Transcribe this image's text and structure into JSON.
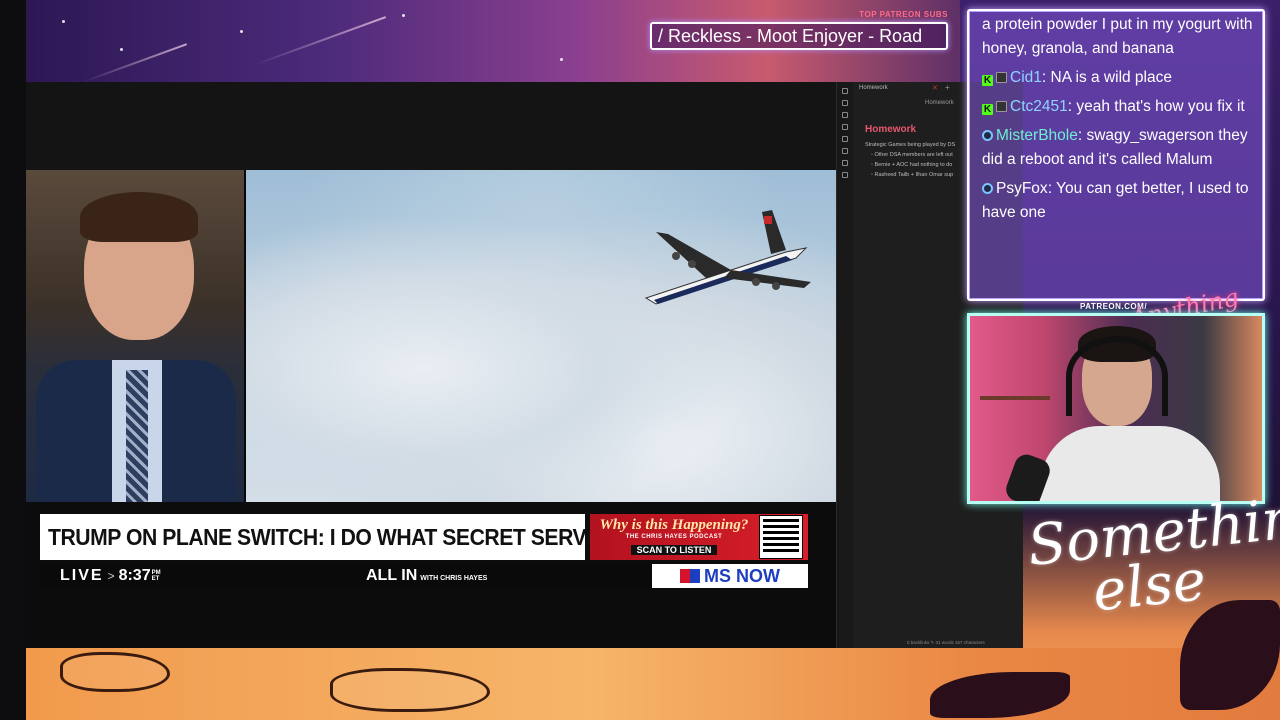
{
  "overlay": {
    "patreon_label": "TOP PATREON SUBS",
    "patreon_names": "/ Reckless - Moot Enjoyer - Road",
    "cam_label": "PATREON.COM/",
    "cam_script": "Anything else",
    "brand_script_line1": "Something",
    "brand_script_line2": "else"
  },
  "news": {
    "headline": "TRUMP ON PLANE SWITCH: I DO WHAT SECRET SERVICE SAYS",
    "promo_title": "Why is this Happening?",
    "promo_sub": "THE CHRIS HAYES PODCAST",
    "promo_scan": "SCAN TO LISTEN",
    "live": "LIVE",
    "time": "8:37",
    "tz_top": "PM",
    "tz_bottom": "ET",
    "show": "ALL IN",
    "show_with": "WITH CHRIS HAYES",
    "network": "MS NOW"
  },
  "notes": {
    "tab": "Homework",
    "crumb": "Homework",
    "title": "Homework",
    "lines": [
      "Strategic Games being played by DS",
      "◦ Other DSA members are left out",
      "◦ Bernie + AOC had nothing to do",
      "◦ Rasheed Tailb + Ilhan Omar sup"
    ],
    "footer": "0 backlinks   ✎   31 words  167 characters"
  },
  "chat": {
    "messages": [
      {
        "badges": [],
        "user": "",
        "user_color": "#ffffff",
        "text": "a protein powder I put in my yogurt with honey, granola, and banana"
      },
      {
        "badges": [
          "k",
          "sq"
        ],
        "user": "Cid1",
        "user_color": "#8fd3ff",
        "text": "NA is a wild place"
      },
      {
        "badges": [
          "k",
          "sq"
        ],
        "user": "Ctc2451",
        "user_color": "#8fd3ff",
        "text": "yeah that's how you fix it"
      },
      {
        "badges": [
          "dot"
        ],
        "user": "MisterBhole",
        "user_color": "#6ef0d0",
        "text": "swagy_swagerson they did a reboot and it's called Malum"
      },
      {
        "badges": [
          "dot"
        ],
        "user": "PsyFox",
        "user_color": "#ffffff",
        "text": "You can get better, I used to have one"
      }
    ]
  },
  "colors": {
    "accent_red": "#d81f2a",
    "network_blue": "#1d3fbf",
    "chat_border_glow": "#c8a2ff",
    "cam_border": "#b7fff3",
    "notes_title": "#e8576d"
  }
}
